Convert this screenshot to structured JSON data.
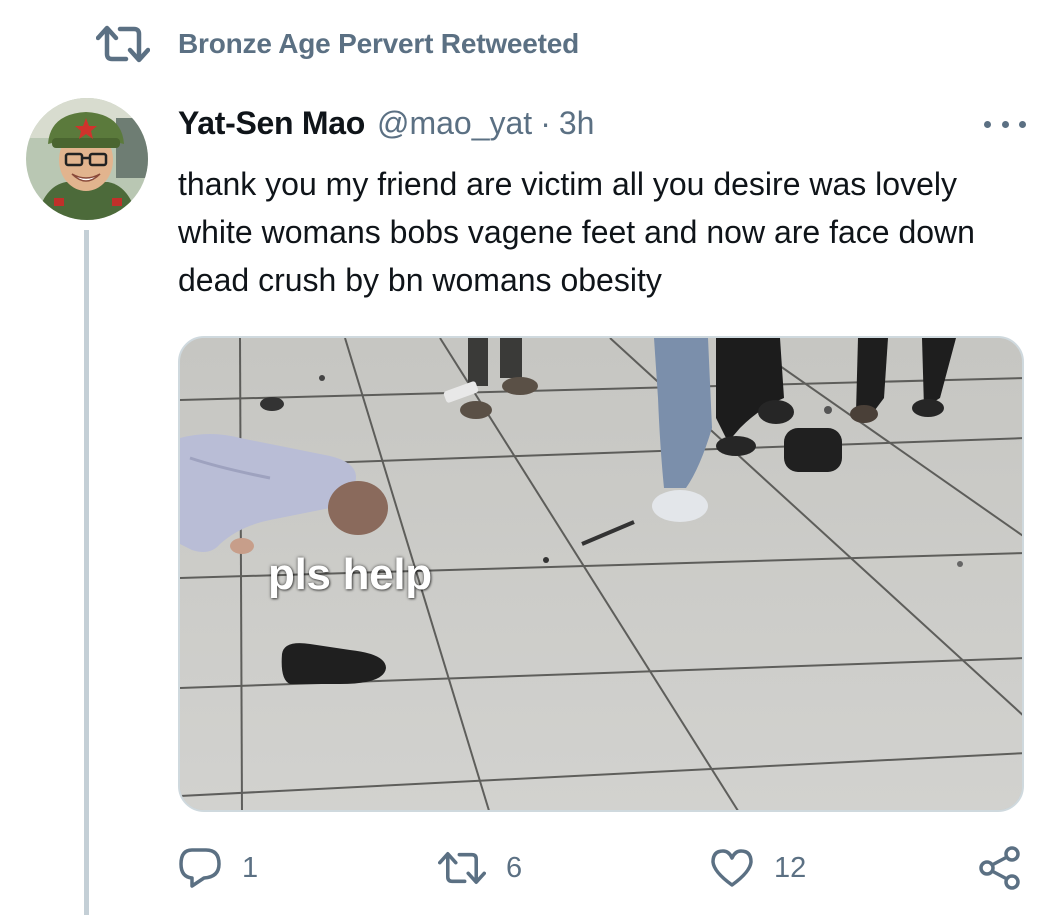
{
  "context": {
    "icon": "retweet-icon",
    "text": "Bronze Age Pervert Retweeted"
  },
  "tweet": {
    "author_name": "Yat-Sen Mao",
    "handle": "@mao_yat",
    "separator": "·",
    "time": "3h",
    "text": "thank you my friend are victim all you desire was lovely white womans bobs vagene feet and now are face down dead crush by bn womans obesity",
    "media": {
      "caption": "pls help"
    }
  },
  "actions": {
    "reply_count": "1",
    "retweet_count": "6",
    "like_count": "12"
  },
  "colors": {
    "secondary_text": "#5b7083",
    "primary_text": "#0f1419",
    "thread_line": "#c4cfd6",
    "media_border": "#cfd9de"
  }
}
